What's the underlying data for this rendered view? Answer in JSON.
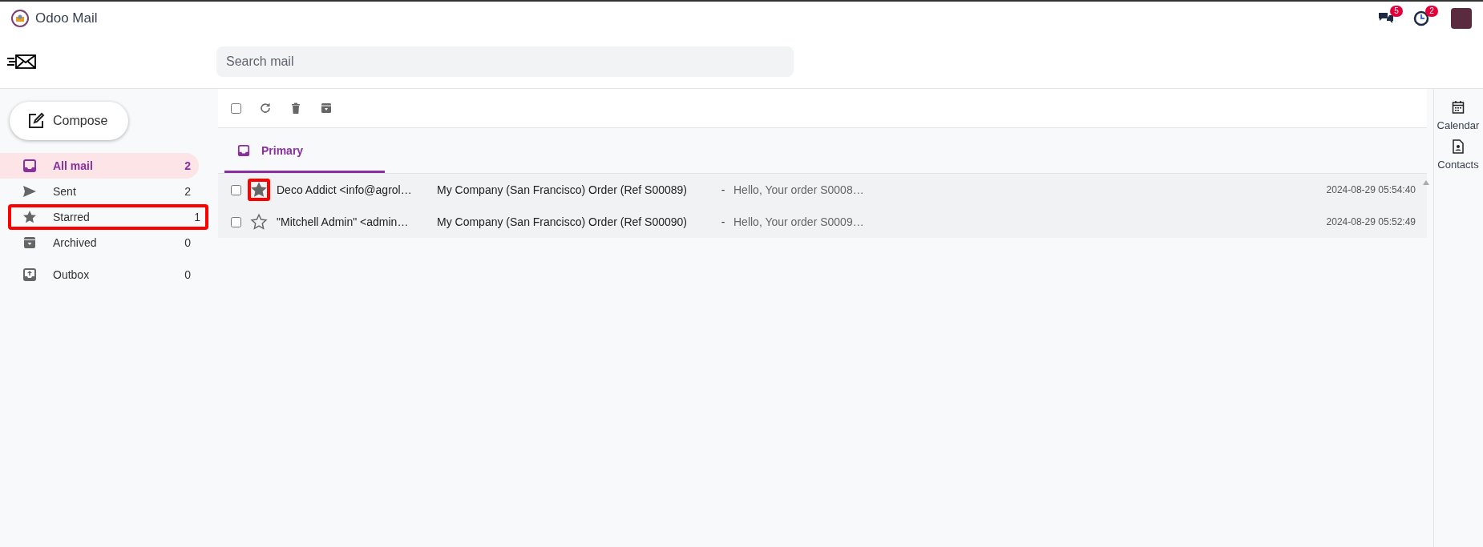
{
  "app": {
    "title": "Odoo Mail",
    "notifications": [
      {
        "kind": "chat",
        "count": "5"
      },
      {
        "kind": "activity",
        "count": "2"
      }
    ]
  },
  "search": {
    "placeholder": "Search mail"
  },
  "compose": {
    "label": "Compose"
  },
  "folders": [
    {
      "kind": "inbox",
      "label": "All mail",
      "count": "2",
      "selected": true,
      "highlighted": false
    },
    {
      "kind": "sent",
      "label": "Sent",
      "count": "2",
      "selected": false,
      "highlighted": false
    },
    {
      "kind": "starred",
      "label": "Starred",
      "count": "1",
      "selected": false,
      "highlighted": true
    },
    {
      "kind": "archived",
      "label": "Archived",
      "count": "0",
      "selected": false,
      "highlighted": false
    },
    {
      "kind": "outbox",
      "label": "Outbox",
      "count": "0",
      "selected": false,
      "highlighted": false
    }
  ],
  "toolbar": {
    "select_all": {
      "checked": false
    }
  },
  "tabs": [
    {
      "label": "Primary",
      "selected": true
    }
  ],
  "messages": [
    {
      "checked": false,
      "starred": true,
      "highlighted": true,
      "sender": "Deco Addict <info@agrol…",
      "subject": "My Company (San Francisco) Order (Ref S00089)",
      "separator": "-",
      "preview": "Hello, Your order S0008…",
      "date": "2024-08-29 05:54:40"
    },
    {
      "checked": false,
      "starred": false,
      "highlighted": false,
      "sender": "\"Mitchell Admin\" <admin…",
      "subject": "My Company (San Francisco) Order (Ref S00090)",
      "separator": "-",
      "preview": "Hello, Your order S0009…",
      "date": "2024-08-29 05:52:49"
    }
  ],
  "side_apps": [
    {
      "kind": "calendar",
      "label": "Calendar"
    },
    {
      "kind": "contacts",
      "label": "Contacts"
    }
  ]
}
